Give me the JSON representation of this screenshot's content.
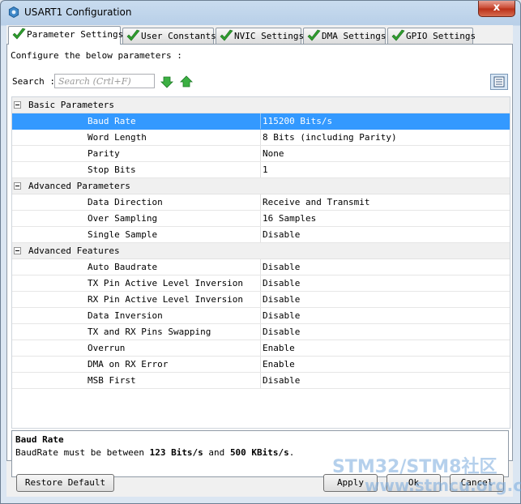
{
  "window": {
    "title": "USART1 Configuration",
    "close_label": "x"
  },
  "tabs": [
    {
      "label": "Parameter Settings",
      "active": true
    },
    {
      "label": "User Constants",
      "active": false
    },
    {
      "label": "NVIC Settings",
      "active": false
    },
    {
      "label": "DMA Settings",
      "active": false
    },
    {
      "label": "GPIO Settings",
      "active": false
    }
  ],
  "panel": {
    "instructions": "Configure the below parameters :",
    "search_label": "Search :",
    "search_placeholder": "Search (Crtl+F)"
  },
  "groups": [
    {
      "name": "Basic Parameters",
      "params": [
        {
          "name": "Baud Rate",
          "value": "115200 Bits/s"
        },
        {
          "name": "Word Length",
          "value": "8 Bits (including Parity)"
        },
        {
          "name": "Parity",
          "value": "None"
        },
        {
          "name": "Stop Bits",
          "value": "1"
        }
      ]
    },
    {
      "name": "Advanced Parameters",
      "params": [
        {
          "name": "Data Direction",
          "value": "Receive and Transmit"
        },
        {
          "name": "Over Sampling",
          "value": "16 Samples"
        },
        {
          "name": "Single Sample",
          "value": "Disable"
        }
      ]
    },
    {
      "name": "Advanced Features",
      "params": [
        {
          "name": "Auto Baudrate",
          "value": "Disable"
        },
        {
          "name": "TX Pin Active Level Inversion",
          "value": "Disable"
        },
        {
          "name": "RX Pin Active Level Inversion",
          "value": "Disable"
        },
        {
          "name": "Data Inversion",
          "value": "Disable"
        },
        {
          "name": "TX and RX Pins Swapping",
          "value": "Disable"
        },
        {
          "name": "Overrun",
          "value": "Enable"
        },
        {
          "name": "DMA on RX Error",
          "value": "Enable"
        },
        {
          "name": "MSB First",
          "value": "Disable"
        }
      ]
    }
  ],
  "description": {
    "title": "Baud Rate",
    "text_before": "BaudRate must be between ",
    "min": "123 Bits/s",
    "middle": " and ",
    "max": "500 KBits/s",
    "text_after": "."
  },
  "buttons": {
    "restore_default": "Restore Default",
    "apply": "Apply",
    "ok": "Ok",
    "cancel": "Cancel"
  },
  "watermark": {
    "line1": "STM32/STM8社区",
    "line2": "www.stmcu.org.cn"
  },
  "colors": {
    "selection": "#3399ff",
    "check_green": "#2e9e2e"
  }
}
